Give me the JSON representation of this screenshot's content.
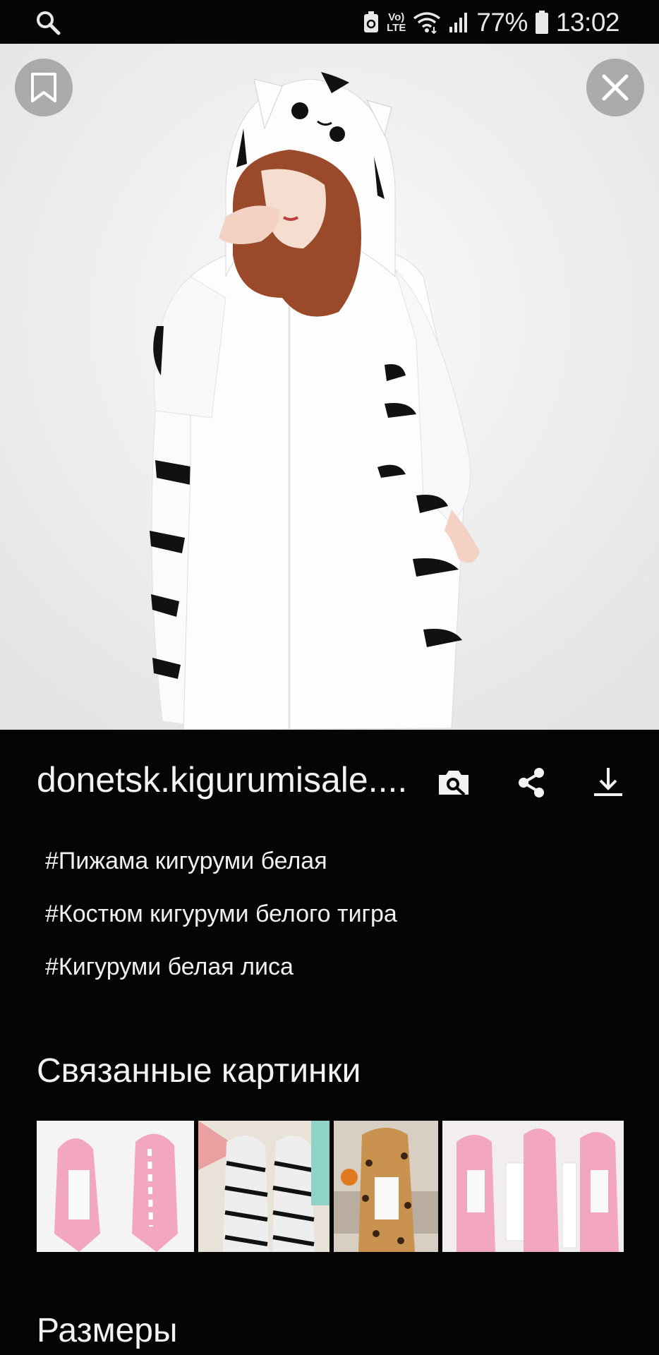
{
  "status_bar": {
    "battery": "77%",
    "time": "13:02",
    "volte_top": "Vo)",
    "volte_bottom": "LTE"
  },
  "image_viewer": {
    "bookmark_icon": "bookmark-icon",
    "close_icon": "close-icon"
  },
  "source": {
    "domain": "donetsk.kigurumisale....",
    "icons": [
      "lens-search-icon",
      "share-icon",
      "download-icon"
    ]
  },
  "tags": [
    "#Пижама кигуруми белая",
    "#Костюм кигуруми белого тигра",
    "#Кигуруми белая лиса"
  ],
  "related": {
    "title": "Связанные картинки"
  },
  "sizes": {
    "title": "Размеры"
  },
  "colors": {
    "background": "#050505",
    "text": "#f2f2f2",
    "button_overlay": "#969696"
  }
}
